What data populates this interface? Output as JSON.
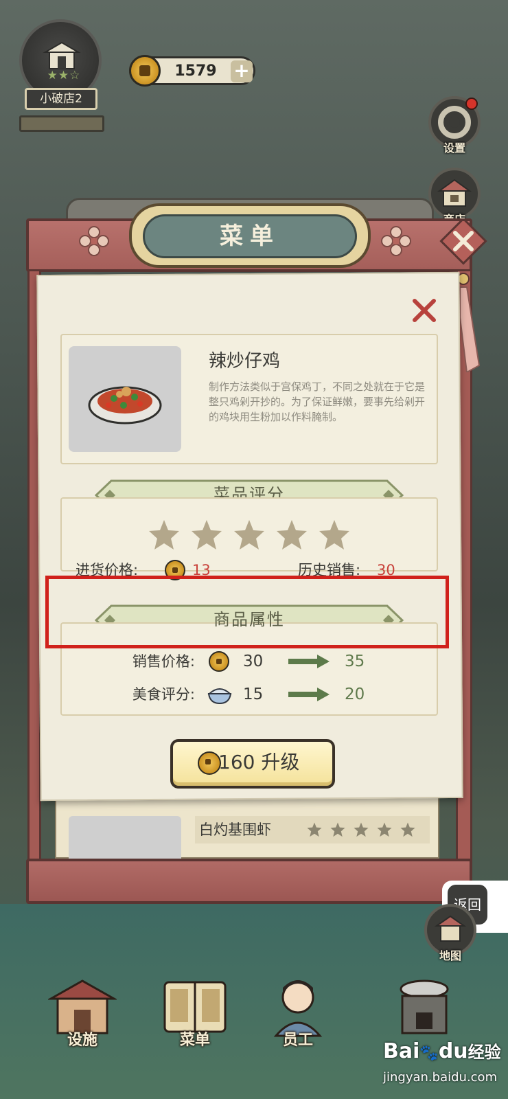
{
  "hud": {
    "shop_name": "小破店2",
    "shop_stars": "★★☆",
    "shop_progress": 0,
    "coins": "1579",
    "plus": "+"
  },
  "side_menu": {
    "settings": "设置",
    "shop": "商店",
    "map": "地图",
    "back": "返回"
  },
  "menu": {
    "title": "菜单",
    "dish": {
      "name": "辣炒仔鸡",
      "description": "制作方法类似于宫保鸡丁，不同之处就在于它是整只鸡剁开抄的。为了保证鲜嫩，要事先给剁开的鸡块用生粉加以作料腌制。"
    },
    "rating_section": {
      "title": "菜品评分",
      "stars": 5,
      "purchase_price_label": "进货价格:",
      "purchase_price": "13",
      "history_sales_label": "历史销售:",
      "history_sales": "30"
    },
    "attributes_section": {
      "title": "商品属性",
      "rows": [
        {
          "label": "销售价格:",
          "icon": "coin-icon",
          "current": "30",
          "next": "35"
        },
        {
          "label": "美食评分:",
          "icon": "bowl-icon",
          "current": "15",
          "next": "20"
        }
      ]
    },
    "upgrade": {
      "cost": "160",
      "label": "升级"
    },
    "next_dish": {
      "name": "白灼基围虾",
      "stars": 5
    }
  },
  "bottom_nav": {
    "facilities": "设施",
    "menu": "菜单",
    "staff": "员工"
  },
  "watermark": {
    "brand": "Bai",
    "brand_suffix": "du",
    "product": "经验",
    "url": "jingyan.baidu.com"
  },
  "colors": {
    "highlight": "#d0211b",
    "price_red": "#c8413a",
    "upgrade_green": "#5f7a4c",
    "board": "#a45b55"
  }
}
